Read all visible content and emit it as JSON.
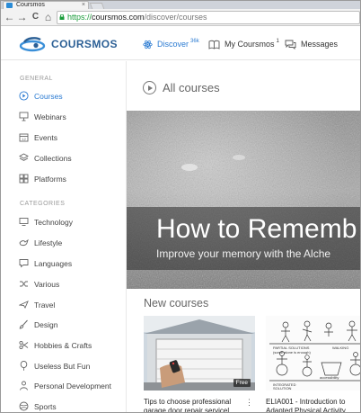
{
  "browser": {
    "tab_title": "Coursmos",
    "tab_close": "×",
    "nav": {
      "back": "←",
      "forward": "→",
      "reload": "C",
      "home": "⌂"
    },
    "url": {
      "scheme": "https://",
      "host": "coursmos.com",
      "path": "/discover/courses"
    }
  },
  "header": {
    "brand": "COURSMOS",
    "nav": [
      {
        "label": "Discover",
        "badge": "36k",
        "icon": "atom-icon",
        "active": true
      },
      {
        "label": "My Coursmos",
        "badge": "1",
        "icon": "book-icon",
        "active": false
      },
      {
        "label": "Messages",
        "badge": "",
        "icon": "chat-icon",
        "active": false
      }
    ]
  },
  "sidebar": {
    "general_label": "GENERAL",
    "general": [
      {
        "label": "Courses",
        "icon": "play-circle-icon",
        "active": true
      },
      {
        "label": "Webinars",
        "icon": "presentation-icon"
      },
      {
        "label": "Events",
        "icon": "calendar-icon"
      },
      {
        "label": "Collections",
        "icon": "layers-icon"
      },
      {
        "label": "Platforms",
        "icon": "grid-icon"
      }
    ],
    "categories_label": "CATEGORIES",
    "categories": [
      {
        "label": "Technology",
        "icon": "monitor-icon"
      },
      {
        "label": "Lifestyle",
        "icon": "bird-icon"
      },
      {
        "label": "Languages",
        "icon": "speech-bubble-icon"
      },
      {
        "label": "Various",
        "icon": "shuffle-icon"
      },
      {
        "label": "Travel",
        "icon": "plane-icon"
      },
      {
        "label": "Design",
        "icon": "brush-icon"
      },
      {
        "label": "Hobbies & Crafts",
        "icon": "scissors-icon"
      },
      {
        "label": "Useless But Fun",
        "icon": "balloon-icon"
      },
      {
        "label": "Personal Development",
        "icon": "person-icon"
      },
      {
        "label": "Sports",
        "icon": "ball-icon"
      }
    ]
  },
  "main": {
    "heading": "All courses",
    "hero": {
      "title": "How to Rememb",
      "subtitle": "Improve your memory with the Alche"
    },
    "new_heading": "New courses",
    "cards": [
      {
        "title": "Tips to choose professional garage door repair servicel",
        "badge": "Free"
      },
      {
        "title": "ELIA001 - Introduction to Adapted Physical Activity",
        "badge": ""
      }
    ],
    "card_menu": "⋮"
  },
  "colors": {
    "accent": "#2b7bd2",
    "brand": "#2b5f95",
    "url_scheme": "#1a9c3a"
  }
}
